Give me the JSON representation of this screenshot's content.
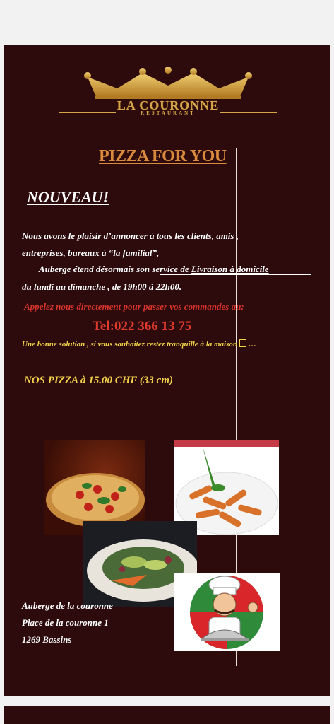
{
  "logo": {
    "name": "LA COURONNE",
    "subtitle": "RESTAURANT",
    "color": "#d6a64a"
  },
  "headline": "PIZZA FOR YOU",
  "nouveau": "NOUVEAU!",
  "paragraph": {
    "line1": "Nous avons le plaisir d’annoncer à tous les clients,  amis ,",
    "line2": "entreprises, bureaux à “la familial”,",
    "line3_prefix": "Auberge étend désormais son service de ",
    "line3_link": "Livraison à domicile",
    "line4": "du lundi au dimanche , de 19h00 à 22h00."
  },
  "call_text": "Appelez nous directement pour passer vos commandes au:",
  "tel": "Tel:022 366 13 75",
  "solution": {
    "before": "Une bonne solution , si vous souhaitez restez tranquille à la maison",
    "after": "…"
  },
  "pizza_price": "NOS PIZZA à 15.00 CHF (33 cm)",
  "photos": {
    "pizza": "pizza-photo",
    "pasta": "pasta-photo",
    "salad": "salad-photo",
    "chef": "chef-illustration"
  },
  "address": {
    "line1": "Auberge de la couronne",
    "line2": "Place de la couronne 1",
    "line3": "1269 Bassins"
  }
}
